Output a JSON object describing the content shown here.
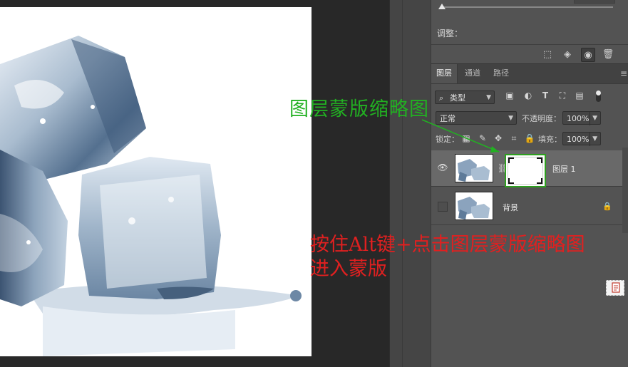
{
  "properties_panel": {
    "adjust_label": "调整："
  },
  "layers_panel": {
    "tabs": [
      "图层",
      "通道",
      "路径"
    ],
    "menu_icon": "panel-menu-icon",
    "filter": {
      "kind_label": "类型"
    },
    "blend_mode": "正常",
    "opacity_label": "不透明度：",
    "opacity_value": "100%",
    "lock_label": "锁定：",
    "fill_label": "填充：",
    "fill_value": "100%",
    "layers": [
      {
        "name": "图层 1",
        "visible": true,
        "selected": true,
        "has_mask": true
      },
      {
        "name": "背景",
        "visible": false,
        "selected": false,
        "locked": true
      }
    ]
  },
  "annotations": {
    "mask_thumbnail_label": "图层蒙版缩略图",
    "instruction_line1": "按住Alt键+点击图层蒙版缩略图",
    "instruction_line2": "进入蒙版",
    "green_color": "#22b022",
    "red_color": "#e02020"
  }
}
